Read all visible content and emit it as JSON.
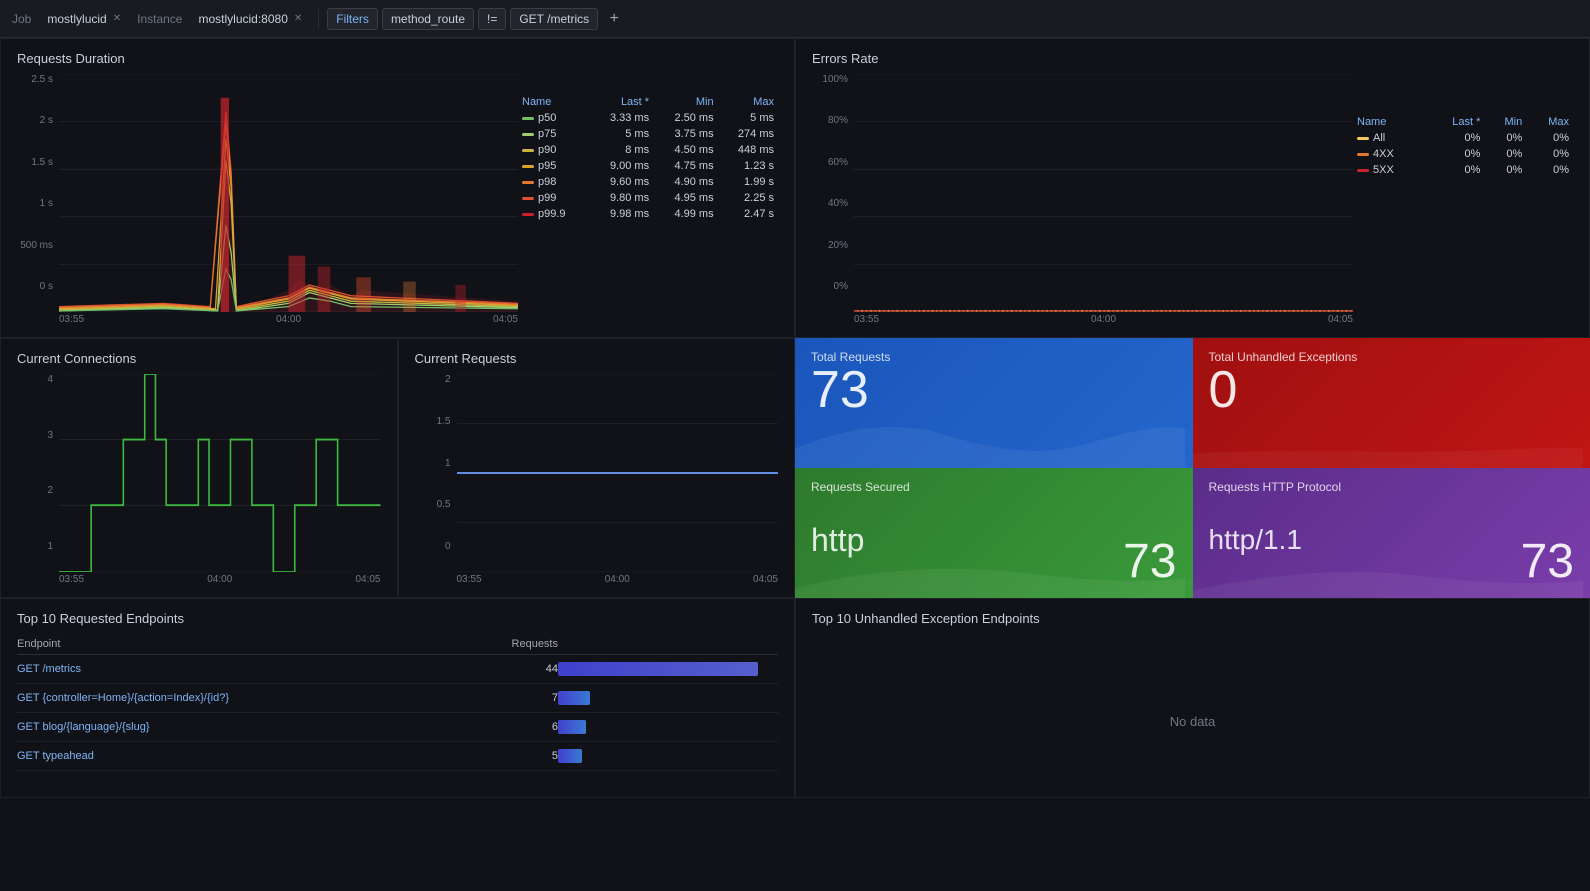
{
  "topbar": {
    "job_label": "Job",
    "job_value": "mostlylucid",
    "instance_label": "Instance",
    "instance_value": "mostlylucid:8080",
    "filters_label": "Filters",
    "filter_key": "method_route",
    "filter_op": "!=",
    "filter_value": "GET /metrics",
    "add_label": "+"
  },
  "requests_duration": {
    "title": "Requests Duration",
    "y_labels": [
      "2.5 s",
      "2 s",
      "1.5 s",
      "1 s",
      "500 ms",
      "0 s"
    ],
    "x_labels": [
      "03:55",
      "04:00",
      "04:05"
    ],
    "legend": [
      {
        "name": "p50",
        "last": "3.33 ms",
        "min": "2.50 ms",
        "max": "5 ms",
        "color": "#73bf69"
      },
      {
        "name": "p75",
        "last": "5 ms",
        "min": "3.75 ms",
        "max": "274 ms",
        "color": "#9ecf6e"
      },
      {
        "name": "p90",
        "last": "8 ms",
        "min": "4.50 ms",
        "max": "448 ms",
        "color": "#c8b642"
      },
      {
        "name": "p95",
        "last": "9.00 ms",
        "min": "4.75 ms",
        "max": "1.23 s",
        "color": "#e0a030"
      },
      {
        "name": "p98",
        "last": "9.60 ms",
        "min": "4.90 ms",
        "max": "1.99 s",
        "color": "#e07830"
      },
      {
        "name": "p99",
        "last": "9.80 ms",
        "min": "4.95 ms",
        "max": "2.25 s",
        "color": "#e05030"
      },
      {
        "name": "p99.9",
        "last": "9.98 ms",
        "min": "4.99 ms",
        "max": "2.47 s",
        "color": "#c8232d"
      }
    ],
    "legend_headers": [
      "Name",
      "Last *",
      "Min",
      "Max"
    ]
  },
  "errors_rate": {
    "title": "Errors Rate",
    "y_labels": [
      "100%",
      "80%",
      "60%",
      "40%",
      "20%",
      "0%"
    ],
    "x_labels": [
      "03:55",
      "04:00",
      "04:05"
    ],
    "legend": [
      {
        "name": "All",
        "last": "0%",
        "min": "0%",
        "max": "0%",
        "color": "#f6c85f"
      },
      {
        "name": "4XX",
        "last": "0%",
        "min": "0%",
        "max": "0%",
        "color": "#e07830"
      },
      {
        "name": "5XX",
        "last": "0%",
        "min": "0%",
        "max": "0%",
        "color": "#c8232d"
      }
    ],
    "legend_headers": [
      "Name",
      "Last *",
      "Min",
      "Max"
    ]
  },
  "current_connections": {
    "title": "Current Connections",
    "y_labels": [
      "4",
      "3",
      "2",
      "1"
    ],
    "x_labels": [
      "03:55",
      "04:00",
      "04:05"
    ]
  },
  "current_requests": {
    "title": "Current Requests",
    "y_labels": [
      "2",
      "1.5",
      "1",
      "0.5",
      "0"
    ],
    "x_labels": [
      "03:55",
      "04:00",
      "04:05"
    ]
  },
  "stat_cards": {
    "total_requests": {
      "title": "Total Requests",
      "value": "73",
      "type": "blue"
    },
    "total_exceptions": {
      "title": "Total Unhandled Exceptions",
      "value": "0",
      "type": "red"
    },
    "requests_secured": {
      "title": "Requests Secured",
      "label": "http",
      "value": "73",
      "type": "green"
    },
    "requests_protocol": {
      "title": "Requests HTTP Protocol",
      "label": "http/1.1",
      "value": "73",
      "type": "purple"
    }
  },
  "top_endpoints": {
    "title": "Top 10 Requested Endpoints",
    "headers": [
      "Endpoint",
      "Requests"
    ],
    "rows": [
      {
        "endpoint": "GET /metrics",
        "count": 44,
        "bar_pct": 100,
        "color": "#5560cc"
      },
      {
        "endpoint": "GET {controller=Home}/{action=Index}/{id?}",
        "count": 7,
        "bar_pct": 16,
        "color": "#3a7ad4"
      },
      {
        "endpoint": "GET blog/{language}/{slug}",
        "count": 6,
        "bar_pct": 14,
        "color": "#3a7ad4"
      },
      {
        "endpoint": "GET typeahead",
        "count": 5,
        "bar_pct": 12,
        "color": "#3a7ad4"
      }
    ]
  },
  "top_exception_endpoints": {
    "title": "Top 10 Unhandled Exception Endpoints",
    "no_data": "No data"
  }
}
